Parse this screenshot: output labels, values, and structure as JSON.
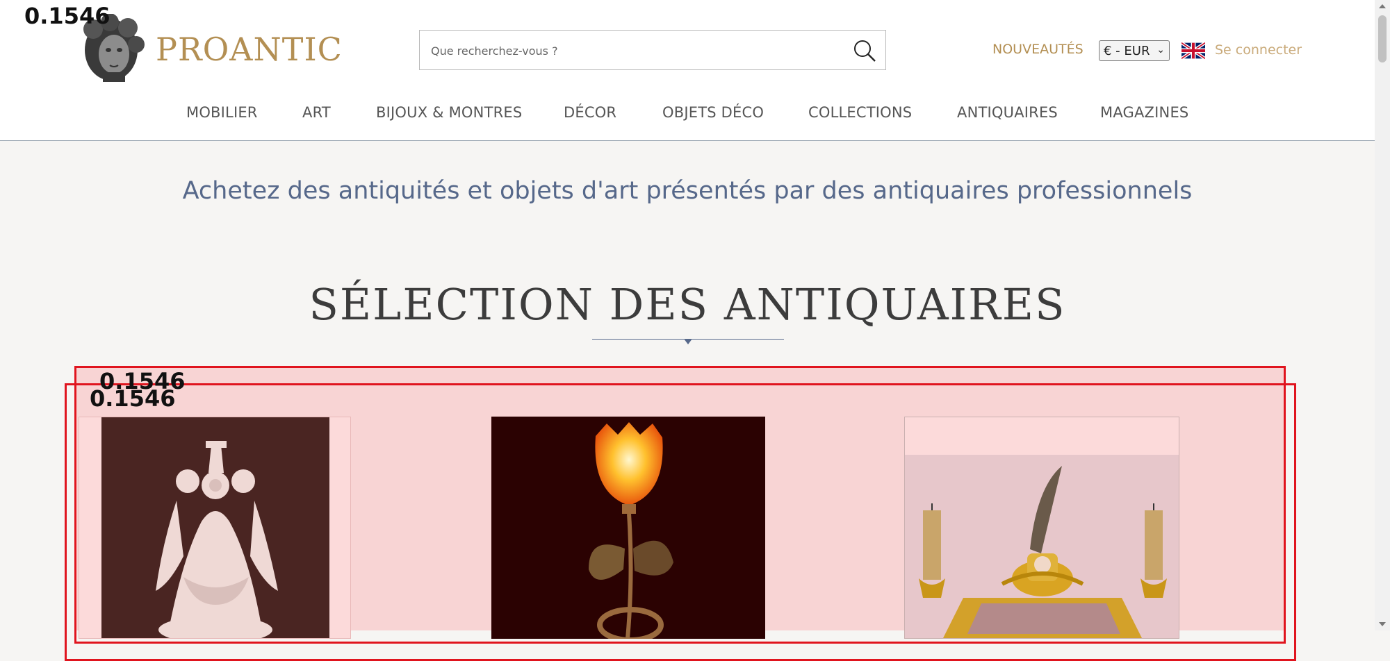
{
  "brand": {
    "name": "PROANTIC",
    "color": "#b38f53"
  },
  "search": {
    "placeholder": "Que recherchez-vous ?",
    "icon": "search-icon"
  },
  "header": {
    "nouveautes": "NOUVEAUTÉS",
    "currency": "€ - EUR",
    "language_icon": "uk-flag-icon",
    "login": "Se connecter"
  },
  "nav": {
    "items": [
      {
        "label": "MOBILIER"
      },
      {
        "label": "ART"
      },
      {
        "label": "BIJOUX & MONTRES"
      },
      {
        "label": "DÉCOR"
      },
      {
        "label": "OBJETS DÉCO"
      },
      {
        "label": "COLLECTIONS"
      },
      {
        "label": "ANTIQUAIRES"
      },
      {
        "label": "MAGAZINES"
      }
    ]
  },
  "hero": {
    "tagline": "Achetez des antiquités et objets d'art présentés par des antiquaires professionnels",
    "section_title": "SÉLECTION DES ANTIQUAIRES"
  },
  "overlay_scores": {
    "logo": "0.1546",
    "frame_a": "0.1546",
    "frame_b": "0.1546"
  },
  "products": [
    {
      "image": "white-porcelain-figurine",
      "icon": "figurine-image"
    },
    {
      "image": "tulip-lamp-with-dragonfly",
      "icon": "lamp-image"
    },
    {
      "image": "gilt-bronze-inkwell-with-candles",
      "icon": "inkwell-image"
    }
  ],
  "colors": {
    "accent": "#b38f53",
    "tagline": "#56688a",
    "frame": "#e0141e",
    "selection_bg": "#f8d4d4"
  }
}
